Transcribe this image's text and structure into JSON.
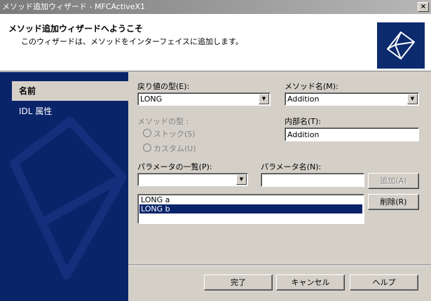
{
  "window": {
    "title": "メソッド追加ウィザード - MFCActiveX1",
    "close_glyph": "×"
  },
  "header": {
    "title": "メソッド追加ウィザードへようこそ",
    "subtitle": "このウィザードは、メソッドをインターフェイスに追加します。"
  },
  "sidebar": {
    "items": [
      {
        "label": "名前",
        "active": true
      },
      {
        "label": "IDL 属性",
        "active": false
      }
    ]
  },
  "form": {
    "return_type_label": "戻り値の型(E):",
    "return_type_value": "LONG",
    "method_name_label": "メソッド名(M):",
    "method_name_value": "Addition",
    "method_type_label": "メソッドの型 :",
    "radio_stock_label": "ストック(S)",
    "radio_custom_label": "カスタム(U)",
    "internal_name_label": "内部名(T):",
    "internal_name_value": "Addition",
    "param_list_label": "パラメータの一覧(P):",
    "param_list_value": "",
    "param_name_label": "パラメータ名(N):",
    "param_name_value": "",
    "add_button": "追加(A)",
    "remove_button": "削除(R)",
    "params": [
      "LONG a",
      "LONG b"
    ],
    "selected_param": 1
  },
  "footer": {
    "finish": "完了",
    "cancel": "キャンセル",
    "help": "ヘルプ"
  },
  "colors": {
    "sidebar_bg": "#0a246a",
    "selection": "#0a246a",
    "dialog_bg": "#d4d0c8"
  },
  "icons": [
    "wizard-cube-icon",
    "close-icon",
    "dropdown-arrow-icon"
  ]
}
